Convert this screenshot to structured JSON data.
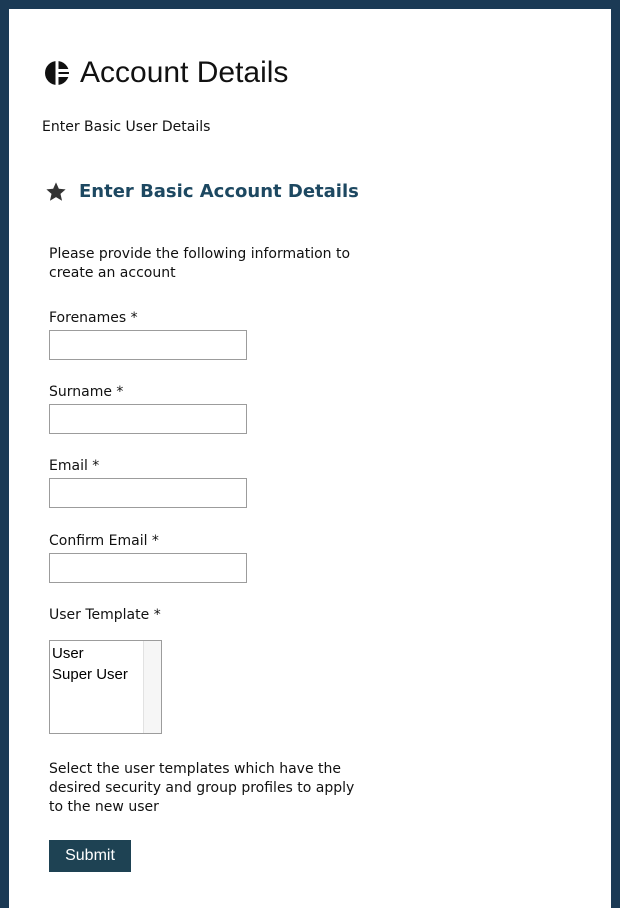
{
  "header": {
    "title": "Account Details",
    "logo_icon": "logo-icon",
    "subtitle": "Enter Basic User Details"
  },
  "section": {
    "icon": "star-icon",
    "title": "Enter Basic Account Details",
    "intro": "Please provide the following information to create an account"
  },
  "form": {
    "forenames_label": "Forenames *",
    "forenames_value": "",
    "surname_label": "Surname *",
    "surname_value": "",
    "email_label": "Email *",
    "email_value": "",
    "confirm_email_label": "Confirm Email *",
    "confirm_email_value": "",
    "user_template_label": "User Template *",
    "user_template_options": [
      "User",
      "Super User"
    ],
    "help_text": "Select the user templates which have the desired security and group profiles to apply to the new user",
    "submit_label": "Submit"
  },
  "colors": {
    "page_border": "#1b3a55",
    "accent": "#1d4861",
    "button_bg": "#1e4253"
  }
}
